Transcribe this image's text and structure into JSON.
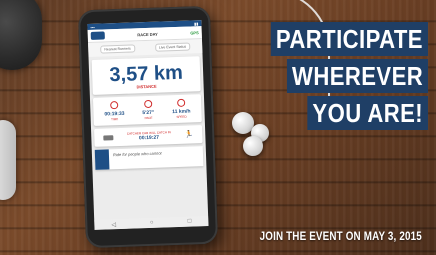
{
  "headline": {
    "lines": [
      "PARTICIPATE",
      "WHEREVER",
      "YOU ARE!"
    ]
  },
  "footer": "JOIN THE EVENT ON MAY 3, 2015",
  "app": {
    "title": "RACE DAY",
    "gps": "GPS",
    "tabs": [
      "Nearest Runners",
      "Live Event Status"
    ],
    "distance": {
      "value": "3,57 km",
      "label": "DISTANCE"
    },
    "stats": [
      {
        "value": "00:19:33",
        "label": "TIME"
      },
      {
        "value": "5'27\"",
        "label": "PACE"
      },
      {
        "value": "11 km/h",
        "label": "SPEED"
      }
    ],
    "remaining": {
      "label": "CATCHER CAR WILL CATCH IN",
      "value": "00:19:27"
    },
    "ad": "Ride for people who cannot"
  },
  "colors": {
    "headline_bg": "#1f3f66",
    "accent_blue": "#1e4f86",
    "accent_red": "#d02b2b"
  }
}
